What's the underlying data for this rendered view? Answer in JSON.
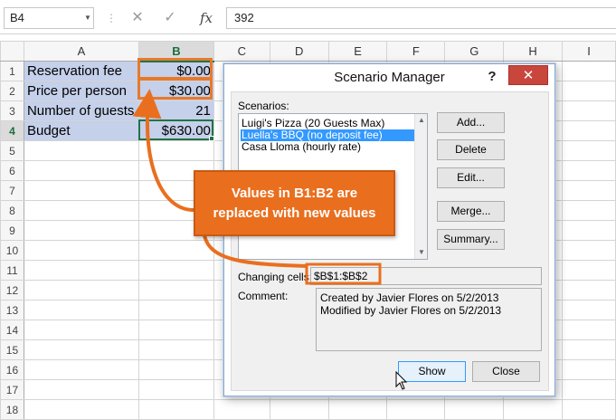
{
  "formula_bar": {
    "name_box": "B4",
    "cancel_glyph": "✕",
    "enter_glyph": "✓",
    "fx_label": "fx",
    "formula": "392"
  },
  "sheet": {
    "columns": [
      "A",
      "B",
      "C",
      "D",
      "E",
      "F",
      "G",
      "H",
      "I"
    ],
    "rows": [
      "1",
      "2",
      "3",
      "4",
      "5",
      "6",
      "7",
      "8",
      "9",
      "10",
      "11",
      "12",
      "13",
      "14",
      "15",
      "16",
      "17",
      "18"
    ],
    "cells": [
      {
        "label": "Reservation fee",
        "value": "$0.00"
      },
      {
        "label": "Price per person",
        "value": "$30.00"
      },
      {
        "label": "Number of guests",
        "value": "21"
      },
      {
        "label": "Budget",
        "value": "$630.00"
      }
    ]
  },
  "dialog": {
    "title": "Scenario Manager",
    "help": "?",
    "close": "✕",
    "scenarios_label": "Scenarios:",
    "scenarios": [
      "Luigi's Pizza (20 Guests Max)",
      "Luella's BBQ (no deposit fee)",
      "Casa Lloma (hourly rate)"
    ],
    "selected_index": 1,
    "buttons": {
      "add": "Add...",
      "delete": "Delete",
      "edit": "Edit...",
      "merge": "Merge...",
      "summary": "Summary...",
      "show": "Show",
      "close": "Close"
    },
    "changing_cells_label": "Changing cells:",
    "changing_cells": "$B$1:$B$2",
    "comment_label": "Comment:",
    "comment_lines": [
      "Created by Javier Flores on 5/2/2013",
      "Modified by Javier Flores on 5/2/2013"
    ]
  },
  "callout": {
    "line1": "Values in B1:B2 are",
    "line2": "replaced with new values",
    "color": "#e96f1f"
  },
  "colors": {
    "selection": "#217346",
    "highlight": "#e7792b",
    "cell_fill": "#c5d0ea",
    "list_selection": "#3399ff",
    "close_button": "#c9463d"
  }
}
